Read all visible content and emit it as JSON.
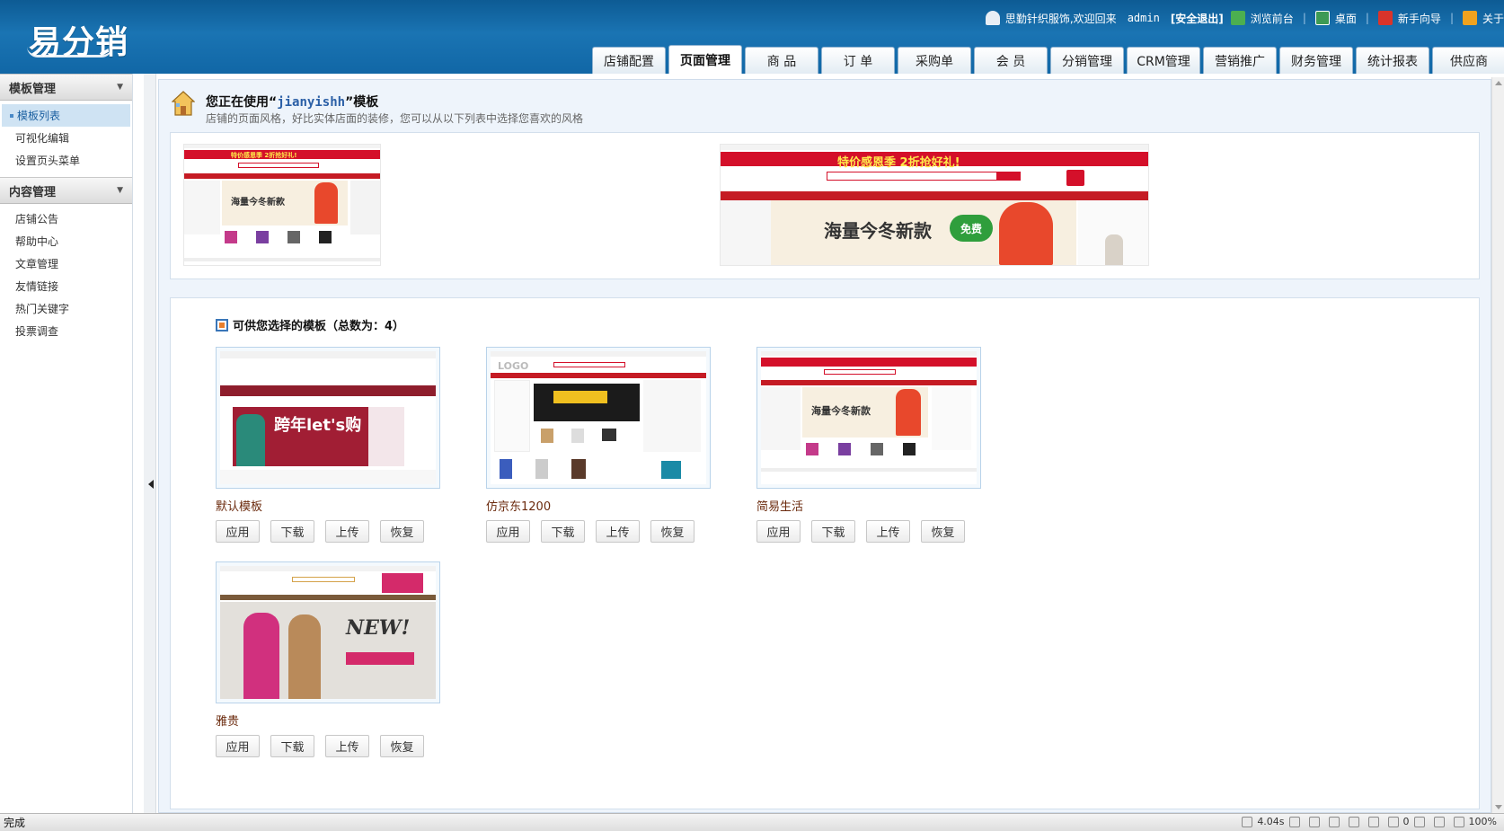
{
  "header": {
    "logo_text": "易分销",
    "welcome": "思勤针织服饰,欢迎回来",
    "username": "admin",
    "logout": "[安全退出]",
    "links": [
      "浏览前台",
      "桌面",
      "新手向导",
      "关于"
    ]
  },
  "nav": {
    "tabs": [
      "店铺配置",
      "页面管理",
      "商 品",
      "订 单",
      "采购单",
      "会 员",
      "分销管理",
      "CRM管理",
      "营销推广",
      "财务管理",
      "统计报表",
      "供应商"
    ],
    "active_index": 1
  },
  "sidebar": {
    "sections": [
      {
        "title": "模板管理",
        "items": [
          "模板列表",
          "可视化编辑",
          "设置页头菜单"
        ]
      },
      {
        "title": "内容管理",
        "items": [
          "店铺公告",
          "帮助中心",
          "文章管理",
          "友情链接",
          "热门关键字",
          "投票调查"
        ]
      }
    ],
    "active_item": "模板列表"
  },
  "current": {
    "title_prefix": "您正在使用“",
    "template_name": "jianyishh",
    "title_suffix": "”模板",
    "subtitle": "店铺的页面风格，好比实体店面的装修，您可以从以下列表中选择您喜欢的风格",
    "banner_text": "海量今冬新款",
    "banner_badge": "免费",
    "promo_text": "特价感恩季 2折抢好礼!"
  },
  "templates": {
    "heading": "可供您选择的模板（总数为：4）",
    "buttons": [
      "应用",
      "下载",
      "上传",
      "恢复"
    ],
    "items": [
      {
        "name": "默认模板",
        "headline": "跨年let's购"
      },
      {
        "name": "仿京东1200",
        "headline": "LOGO"
      },
      {
        "name": "简易生活",
        "headline": "海量今冬新款"
      },
      {
        "name": "雅贵",
        "headline": "NEW!"
      }
    ]
  },
  "status": {
    "left": "完成",
    "time": "4.04s",
    "count": "0",
    "zoom": "100%"
  },
  "colors": {
    "header_blue": "#1a74b3",
    "promo_red": "#d4102a",
    "name_brown": "#6b2a0d",
    "link_blue": "#2b5fa6"
  }
}
